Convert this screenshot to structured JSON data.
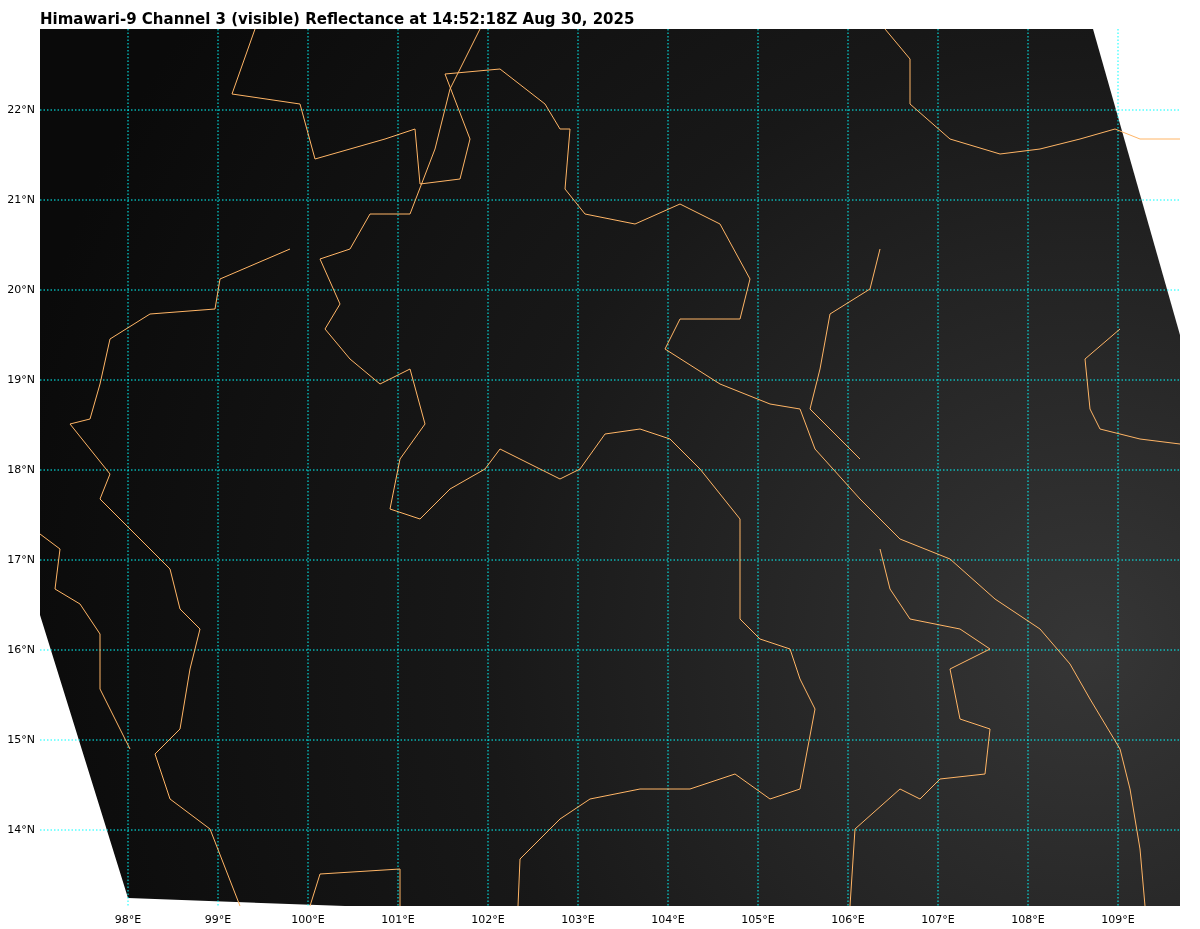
{
  "title": "Himawari-9 Channel 3 (visible) Reflectance at 14:52:18Z Aug 30, 2025",
  "map": {
    "lat_labels": [
      "22°N",
      "21°N",
      "20°N",
      "19°N",
      "18°N",
      "17°N",
      "16°N",
      "15°N",
      "14°N"
    ],
    "lon_labels": [
      "98°E",
      "99°E",
      "100°E",
      "101°E",
      "102°E",
      "103°E",
      "104°E",
      "105°E",
      "106°E",
      "107°E",
      "108°E",
      "109°E"
    ]
  }
}
